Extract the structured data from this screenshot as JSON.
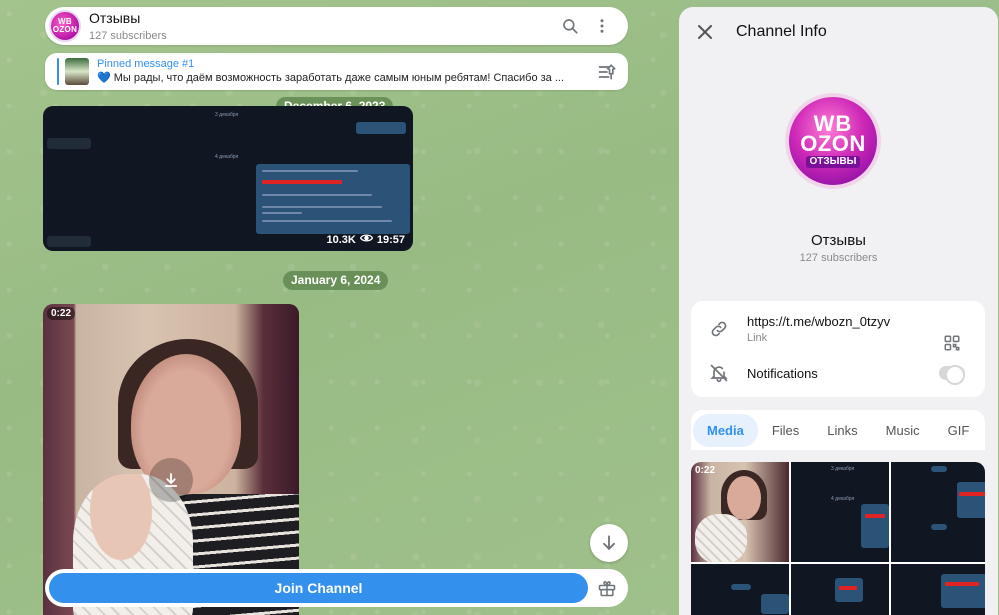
{
  "channel": {
    "name": "Отзывы",
    "subscribers": "127 subscribers",
    "avatar_text": [
      "WB",
      "OZON",
      "ОТЗЫВЫ"
    ]
  },
  "header": {
    "search_icon": "search-icon",
    "more_icon": "more-vertical-icon"
  },
  "pinned": {
    "title": "Pinned message #1",
    "text": "💙 Мы рады, что даём возможность заработать даже самым юным ребятам! Спасибо за ..."
  },
  "dates": [
    "December 6, 2023",
    "January 6, 2024"
  ],
  "messages": {
    "screenshot": {
      "views": "10.3K",
      "time": "19:57"
    },
    "video": {
      "duration": "0:22"
    }
  },
  "bottom": {
    "join_label": "Join Channel"
  },
  "panel": {
    "title": "Channel Info",
    "name": "Отзывы",
    "subscribers": "127 subscribers",
    "link": "https://t.me/wbozn_0tzyv",
    "link_caption": "Link",
    "notifications_label": "Notifications",
    "notifications_on": false,
    "tabs": [
      "Media",
      "Files",
      "Links",
      "Music",
      "GIF",
      "V"
    ],
    "active_tab": "Media",
    "media_first_duration": "0:22"
  },
  "colors": {
    "accent": "#3390ec",
    "chat_bg": "#9cbe8a",
    "panel_bg": "#f1f1f4"
  }
}
